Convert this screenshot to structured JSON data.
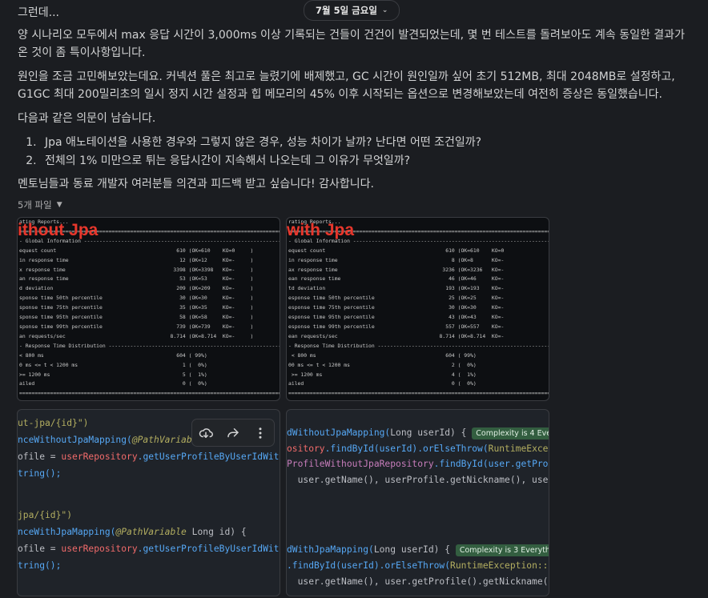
{
  "date_divider": "7월 5일 금요일",
  "message": {
    "lines": [
      "그런데...",
      "양 시나리오 모두에서 max 응답 시간이 3,000ms 이상 기록되는 건들이 건건이 발견되었는데, 몇 번 테스트를 돌려보아도 계속 동일한 결과가",
      "온 것이 좀 특이사항입니다.",
      "원인을 조금 고민해보았는데요. 커넥션 풀은 최고로 늘렸기에 배제했고, GC 시간이 원인일까 싶어 초기 512MB, 최대 2048MB로 설정하고,",
      "G1GC 최대 200밀리초의 일시 정지 시간 설정과 힙 메모리의 45% 이후 시작되는 옵션으로 변경해보았는데 여전히 증상은 동일했습니다.",
      "다음과 같은 의문이 남습니다."
    ],
    "list": [
      "Jpa 애노테이션을 사용한 경우와 그렇지 않은 경우, 성능 차이가 날까? 난다면 어떤 조건일까?",
      "전체의 1% 미만으로 튀는 응답시간이 지속해서 나오는데 그 이유가 무엇일까?"
    ],
    "closing": "멘토님들과 동료 개발자 여러분들 의견과 피드백 받고 싶습니다! 감사합니다.",
    "files_label": "5개 파일"
  },
  "thumbs": {
    "without": {
      "overlay": "ithout Jpa",
      "lines": [
        "ating Reports...",
        "=========================================================================================",
        "- Global Information --------------------------------------------------------------------",
        "equest count                                       610 (OK=610    KO=0     )",
        "in response time                                    12 (OK=12     KO=-     )",
        "x response time                                   3398 (OK=3398   KO=-     )",
        "an response time                                    53 (OK=53     KO=-     )",
        "d deviation                                        209 (OK=209    KO=-     )",
        "sponse time 50th percentile                         30 (OK=30     KO=-     )",
        "sponse time 75th percentile                         35 (OK=35     KO=-     )",
        "sponse time 95th percentile                         58 (OK=58     KO=-     )",
        "sponse time 99th percentile                        739 (OK=739    KO=-     )",
        "an requests/sec                                  8.714 (OK=8.714  KO=-     )",
        "- Response Time Distribution ------------------------------------------------------------",
        "< 800 ms                                           604 ( 99%)",
        "0 ms <= t < 1200 ms                                  1 (  0%)",
        ">= 1200 ms                                           5 (  1%)",
        "ailed                                                0 (  0%)",
        "========================================================================================="
      ]
    },
    "with": {
      "overlay": "with Jpa",
      "lines": [
        "rating Reports...",
        "=========================================================================================",
        "- Global Information --------------------------------------------------------------------",
        "equest count                                       610 (OK=610    KO=0",
        "in response time                                     8 (OK=8      KO=-",
        "ax response time                                  3236 (OK=3236   KO=-",
        "ean response time                                   46 (OK=46     KO=-",
        "td deviation                                       193 (OK=193    KO=-",
        "esponse time 50th percentile                        25 (OK=25     KO=-",
        "esponse time 75th percentile                        30 (OK=30     KO=-",
        "esponse time 95th percentile                        43 (OK=43     KO=-",
        "esponse time 99th percentile                       557 (OK=557    KO=-",
        "ean requests/sec                                 8.714 (OK=8.714  KO=-",
        "- Response Time Distribution ------------------------------------------------------------",
        " < 800 ms                                          604 ( 99%)",
        "00 ms <= t < 1200 ms                                 2 (  0%)",
        " >= 1200 ms                                          4 (  1%)",
        "ailed                                                0 (  0%)",
        "========================================================================================="
      ]
    },
    "code_left": {
      "l1a": "ut-jpa/{id}\")",
      "l2a": "nceWithoutJpaMapping(",
      "l2b": "@PathVariab",
      "l3a": "ofile = ",
      "l3b": "userRepository",
      "l3c": ".getUserProfileByUserIdWit",
      "l4a": "tring();",
      "l5a": "jpa/{id}\")",
      "l6a": "nceWithJpaMapping(",
      "l6b": "@PathVariable",
      "l6c": " Long id) {",
      "l7a": "ofile = ",
      "l7b": "userRepository",
      "l7c": ".getUserProfileByUserIdWit",
      "l8a": "tring();"
    },
    "code_right": {
      "l1a": "dWithoutJpaMapping(",
      "l1b": "Long userId) {",
      "badge1": "Complexity is 4 Everyth",
      "l2a": "ository",
      "l2b": ".findById(userId).orElseThrow(",
      "l2c": "RuntimeExcepti",
      "l3a": "ProfileWithoutJpaRepository",
      "l3b": ".findById(user.getProfi",
      "l4a": "  user.getName(), userProfile.getNickname(), userPro",
      "l5a": "dWithJpaMapping(",
      "l5b": "Long userId) {",
      "badge2": "Complexity is 3 Everything",
      "l6a": ".findById(userId).orElseThrow(",
      "l6b": "RuntimeException::new",
      "l7a": "  user.getName(), user.getProfile().getNickname(), u"
    }
  },
  "toolbar": {
    "download_icon": "cloud-download-icon",
    "share_icon": "share-icon",
    "more_icon": "more-vertical-icon"
  }
}
